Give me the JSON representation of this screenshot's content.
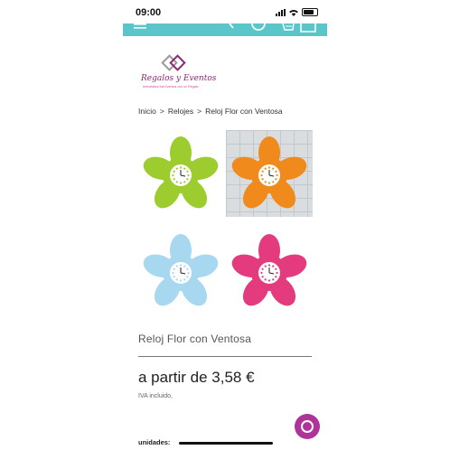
{
  "status_bar": {
    "time": "09:00"
  },
  "header": {
    "bg_color": "#5bc6c9"
  },
  "logo": {
    "name": "Regalos y Eventos",
    "tagline": "Inmortaliza tus Eventos con un Regalo",
    "colors": [
      "#8b2a76",
      "#d04aa3",
      "#9a9a9a"
    ]
  },
  "breadcrumb": {
    "home": "Inicio",
    "sep": ">",
    "category": "Relojes",
    "current": "Reloj Flor con Ventosa"
  },
  "gallery": [
    {
      "name": "green",
      "color": "#9ccc2e"
    },
    {
      "name": "orange",
      "color": "#f08a1c"
    },
    {
      "name": "light-blue",
      "color": "#a8d8ef"
    },
    {
      "name": "pink",
      "color": "#e43a7e"
    }
  ],
  "product": {
    "title": "Reloj Flor con Ventosa",
    "price": "a partir de 3,58 €",
    "tax_note": "IVA incluido,"
  },
  "form": {
    "units_label": "unidades:"
  },
  "chat": {
    "color": "#b0339a",
    "icon": "chat-bubble-icon"
  }
}
